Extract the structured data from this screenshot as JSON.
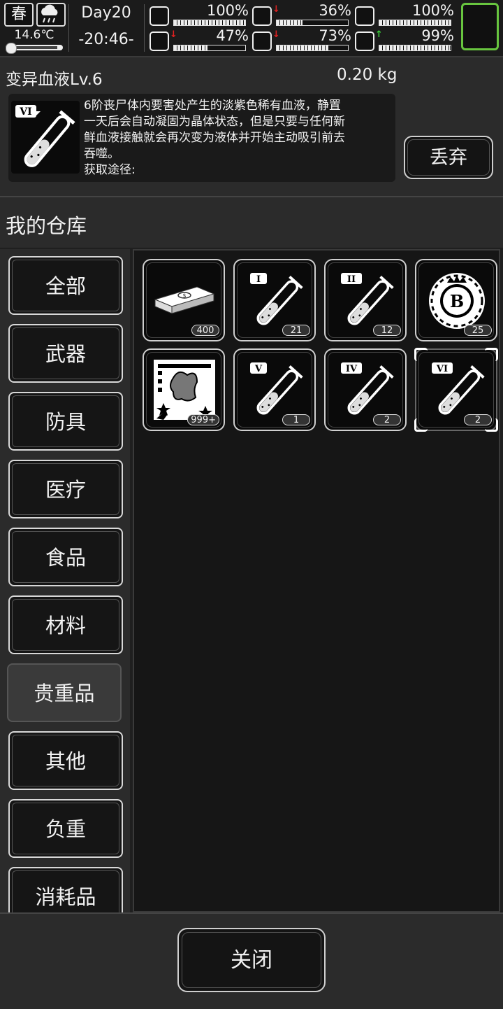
{
  "status": {
    "season": "春",
    "temperature": "14.6℃",
    "day": "Day20",
    "time": "-20:46-",
    "stats": [
      {
        "icon": "health-kit-icon",
        "value": "100%",
        "level": 1.0,
        "arrow": ""
      },
      {
        "icon": "stomach-icon",
        "value": "36%",
        "level": 0.36,
        "arrow": "down"
      },
      {
        "icon": "pill-icon",
        "value": "100%",
        "level": 1.0,
        "arrow": ""
      },
      {
        "icon": "boot-icon",
        "value": "47%",
        "level": 0.47,
        "arrow": "down"
      },
      {
        "icon": "water-drop-icon",
        "value": "73%",
        "level": 0.73,
        "arrow": "down"
      },
      {
        "icon": "heart-icon",
        "value": "99%",
        "level": 0.99,
        "arrow": "up"
      }
    ],
    "arrow_colors": {
      "down": "#e02020",
      "up": "#3ad13a"
    }
  },
  "item": {
    "name": "变异血液Lv.6",
    "weight": "0.20 kg",
    "description": "6阶丧尸体内要害处产生的淡紫色稀有血液，静置\n一天后会自动凝固为晶体状态，但是只要与任何新\n鲜血液接触就会再次变为液体并开始主动吸引前去\n吞噬。\n获取途径:",
    "icon_label": "VI",
    "discard_label": "丢弃"
  },
  "warehouse": {
    "title": "我的仓库",
    "categories": [
      "全部",
      "武器",
      "防具",
      "医疗",
      "食品",
      "材料",
      "贵重品",
      "其他",
      "负重",
      "消耗品"
    ],
    "selected_category": "贵重品",
    "items": [
      {
        "icon": "cash-bundle-icon",
        "label": "",
        "qty": "400"
      },
      {
        "icon": "blood-vial-icon",
        "label": "I",
        "qty": "21"
      },
      {
        "icon": "blood-vial-icon",
        "label": "II",
        "qty": "12"
      },
      {
        "icon": "bitcoin-chip-icon",
        "label": "B",
        "qty": "25"
      },
      {
        "icon": "zombie-card-icon",
        "label": "",
        "qty": "999+"
      },
      {
        "icon": "blood-vial-icon",
        "label": "V",
        "qty": "1"
      },
      {
        "icon": "blood-vial-icon",
        "label": "IV",
        "qty": "2"
      },
      {
        "icon": "blood-vial-icon",
        "label": "VI",
        "qty": "2"
      }
    ],
    "selected_item_index": 7
  },
  "footer": {
    "close_label": "关闭"
  },
  "colors": {
    "slot_border": "#68c53f"
  }
}
